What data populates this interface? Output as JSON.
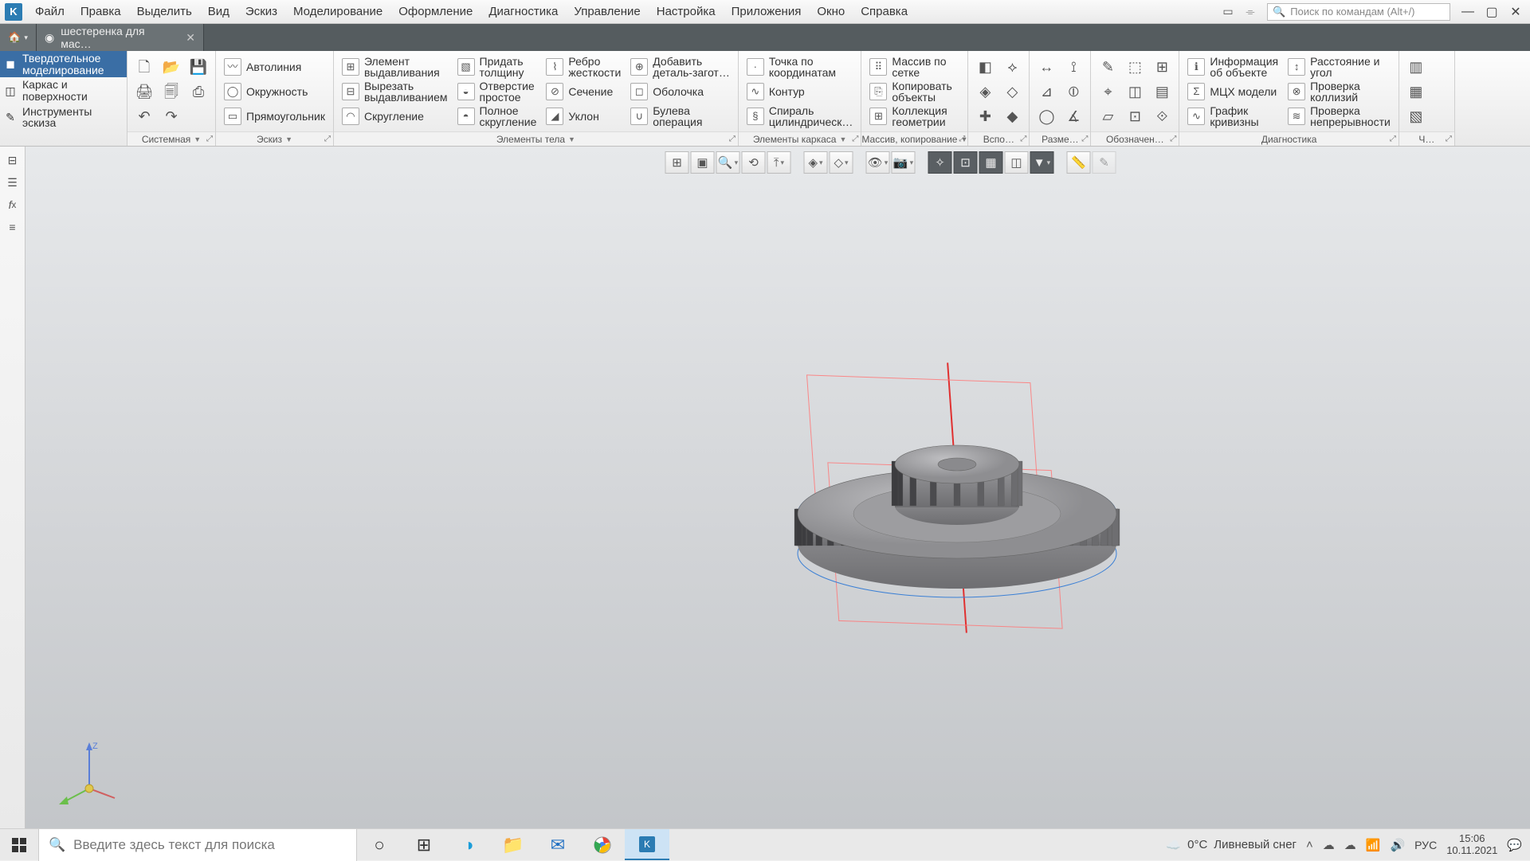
{
  "menubar": {
    "items": [
      "Файл",
      "Правка",
      "Выделить",
      "Вид",
      "Эскиз",
      "Моделирование",
      "Оформление",
      "Диагностика",
      "Управление",
      "Настройка",
      "Приложения",
      "Окно",
      "Справка"
    ],
    "search_placeholder": "Поиск по командам (Alt+/)"
  },
  "tabs": {
    "doc_title": "шестеренка для мас…"
  },
  "left_column": {
    "items": [
      {
        "label": "Твердотельное\nмоделирование",
        "active": true
      },
      {
        "label": "Каркас и\nповерхности"
      },
      {
        "label": "Инструменты\nэскиза"
      }
    ]
  },
  "groups": [
    {
      "title": "Системная",
      "cols": [
        [
          {
            "ic": "🗋"
          },
          {
            "ic": "🖨"
          },
          {
            "ic": "↶"
          }
        ],
        [
          {
            "ic": "📂"
          },
          {
            "ic": "🗐"
          },
          {
            "ic": "↷"
          }
        ],
        [
          {
            "ic": "💾"
          },
          {
            "ic": "⎙"
          },
          {
            "ic": " "
          }
        ]
      ],
      "dd": true,
      "exp": true
    },
    {
      "title": "Эскиз",
      "cols": [
        [
          {
            "ic": "〰",
            "label": "Автолиния"
          },
          {
            "ic": "◯",
            "label": "Окружность"
          },
          {
            "ic": "▭",
            "label": "Прямоугольник"
          }
        ]
      ],
      "dd": true,
      "exp": true
    },
    {
      "title": "Элементы тела",
      "cols": [
        [
          {
            "ic": "⊞",
            "label": "Элемент\nвыдавливания"
          },
          {
            "ic": "⊟",
            "label": "Вырезать\nвыдавливанием"
          },
          {
            "ic": "◠",
            "label": "Скругление"
          }
        ],
        [
          {
            "ic": "▧",
            "label": "Придать\nтолщину"
          },
          {
            "ic": "◒",
            "label": "Отверстие\nпростое"
          },
          {
            "ic": "◓",
            "label": "Полное\nскругление"
          }
        ],
        [
          {
            "ic": "⌇",
            "label": "Ребро\nжесткости"
          },
          {
            "ic": "⊘",
            "label": "Сечение"
          },
          {
            "ic": "◢",
            "label": "Уклон"
          }
        ],
        [
          {
            "ic": "⊕",
            "label": "Добавить\nдеталь-загот…"
          },
          {
            "ic": "◻",
            "label": "Оболочка"
          },
          {
            "ic": "∪",
            "label": "Булева\nоперация"
          }
        ]
      ],
      "dd": true,
      "exp": true
    },
    {
      "title": "Элементы каркаса",
      "cols": [
        [
          {
            "ic": "·",
            "label": "Точка по\nкоординатам"
          },
          {
            "ic": "∿",
            "label": "Контур"
          },
          {
            "ic": "§",
            "label": "Спираль\nцилиндрическ…"
          }
        ]
      ],
      "dd": true,
      "exp": true
    },
    {
      "title": "Массив, копирование",
      "cols": [
        [
          {
            "ic": "⠿",
            "label": "Массив по\nсетке"
          },
          {
            "ic": "⎘",
            "label": "Копировать\nобъекты"
          },
          {
            "ic": "⊞",
            "label": "Коллекция\nгеометрии"
          }
        ]
      ],
      "dd": true,
      "exp": true
    },
    {
      "title": "Вспо…",
      "cols": [
        [
          {
            "ic": "◧"
          },
          {
            "ic": "◈"
          },
          {
            "ic": "✚"
          }
        ],
        [
          {
            "ic": "⟡"
          },
          {
            "ic": "◇"
          },
          {
            "ic": "◆"
          }
        ]
      ],
      "exp": true
    },
    {
      "title": "Разме…",
      "cols": [
        [
          {
            "ic": "↔"
          },
          {
            "ic": "⊿"
          },
          {
            "ic": "◯"
          }
        ],
        [
          {
            "ic": "⟟"
          },
          {
            "ic": "⦶"
          },
          {
            "ic": "∡"
          }
        ]
      ],
      "exp": true
    },
    {
      "title": "Обозначен…",
      "cols": [
        [
          {
            "ic": "✎"
          },
          {
            "ic": "⌖"
          },
          {
            "ic": "▱"
          }
        ],
        [
          {
            "ic": "⬚"
          },
          {
            "ic": "◫"
          },
          {
            "ic": "⊡"
          }
        ],
        [
          {
            "ic": "⊞"
          },
          {
            "ic": "▤"
          },
          {
            "ic": "⟐"
          }
        ]
      ],
      "exp": true
    },
    {
      "title": "Диагностика",
      "cols": [
        [
          {
            "ic": "ℹ",
            "label": "Информация\nоб объекте"
          },
          {
            "ic": "Σ",
            "label": "МЦХ модели"
          },
          {
            "ic": "∿",
            "label": "График\nкривизны"
          }
        ],
        [
          {
            "ic": "↕",
            "label": "Расстояние и\nугол"
          },
          {
            "ic": "⊗",
            "label": "Проверка\nколлизий"
          },
          {
            "ic": "≋",
            "label": "Проверка\nнепрерывности"
          }
        ]
      ],
      "exp": true
    },
    {
      "title": "Ч…",
      "cols": [
        [
          {
            "ic": "▥"
          },
          {
            "ic": "▦"
          },
          {
            "ic": "▧"
          }
        ]
      ],
      "exp": true
    }
  ],
  "taskbar": {
    "search_placeholder": "Введите здесь текст для поиска",
    "weather_temp": "0°C",
    "weather_text": "Ливневый снег",
    "lang": "РУС",
    "time": "15:06",
    "date": "10.11.2021"
  },
  "gizmo": {
    "z": "Z"
  }
}
